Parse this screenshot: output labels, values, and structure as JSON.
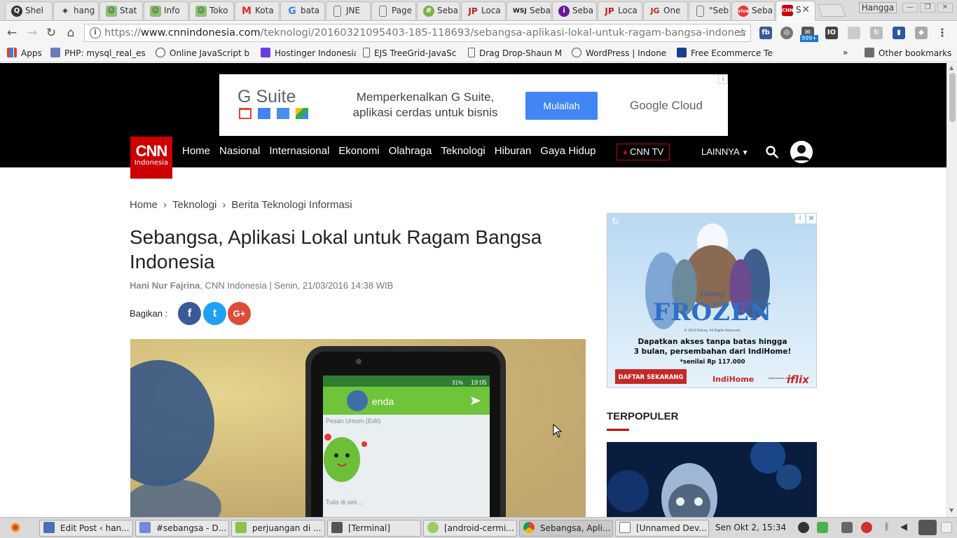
{
  "browser": {
    "tabs": [
      {
        "label": "Shel",
        "icon": "q-icon"
      },
      {
        "label": "hang",
        "icon": "superman-icon"
      },
      {
        "label": "Stat",
        "icon": "robot-icon"
      },
      {
        "label": "Info",
        "icon": "robot-icon"
      },
      {
        "label": "Toko",
        "icon": "robot-icon"
      },
      {
        "label": "Kota",
        "icon": "gmail-icon"
      },
      {
        "label": "bata",
        "icon": "google-icon"
      },
      {
        "label": "JNE",
        "icon": "page-icon"
      },
      {
        "label": "Page",
        "icon": "page-icon"
      },
      {
        "label": "Seba",
        "icon": "sheet-icon"
      },
      {
        "label": "Loca",
        "icon": "jp-icon"
      },
      {
        "label": "Seba",
        "icon": "wsj-icon"
      },
      {
        "label": "Seba",
        "icon": "info-icon"
      },
      {
        "label": "Loca",
        "icon": "jp-icon"
      },
      {
        "label": "One",
        "icon": "jg-icon"
      },
      {
        "label": "\"Seb",
        "icon": "page-icon"
      },
      {
        "label": "Seba",
        "icon": "viva-icon"
      },
      {
        "label": "S",
        "icon": "cnn-icon",
        "active": true
      }
    ],
    "profile_name": "Hangga",
    "url_protocol": "https://",
    "url_domain": "www.cnnindonesia.com",
    "url_path": "/teknologi/20160321095403-185-118693/sebangsa-aplikasi-lokal-untuk-ragam-bangsa-indones",
    "ext_badge": "999+",
    "ext_fb": "fb"
  },
  "bookmarks": [
    {
      "label": "Apps"
    },
    {
      "label": "PHP: mysql_real_esc"
    },
    {
      "label": "Online JavaScript be"
    },
    {
      "label": "Hostinger Indonesia"
    },
    {
      "label": "EJS TreeGrid-JavaScr"
    },
    {
      "label": "Drag Drop-Shaun Mc"
    },
    {
      "label": "WordPress | Indones"
    },
    {
      "label": "Free Ecommerce Ter"
    }
  ],
  "bookmarks_more": "»",
  "bookmarks_other": "Other bookmarks",
  "ad_top": {
    "brand": "G Suite",
    "text": "Memperkenalkan G Suite, aplikasi cerdas untuk bisnis",
    "button": "Mulailah",
    "partner": "Google Cloud"
  },
  "site": {
    "logo_main": "CNN",
    "logo_sub": "Indonesia",
    "nav": [
      "Home",
      "Nasional",
      "Internasional",
      "Ekonomi",
      "Olahraga",
      "Teknologi",
      "Hiburan",
      "Gaya Hidup"
    ],
    "cnn_tv": "CNN TV",
    "more": "LAINNYA"
  },
  "article": {
    "breadcrumb": [
      "Home",
      "Teknologi",
      "Berita Teknologi Informasi"
    ],
    "title": "Sebangsa, Aplikasi Lokal untuk Ragam Bangsa Indonesia",
    "author": "Hani Nur Fajrina",
    "meta": ", CNN Indonesia | Senin, 21/03/2016 14:38 WIB",
    "share_label": "Bagikan :",
    "share_buttons": [
      "f",
      "t",
      "G+"
    ],
    "photo_app_name": "enda",
    "photo_field_1": "Pesan Umum (Edit)",
    "photo_field_2": "Tulis di sini ...",
    "photo_status_time": "19:05",
    "photo_status_battery": "31%"
  },
  "side_ad": {
    "title": "FROZEN",
    "brand": "Disney",
    "copyright": "© 2013 Disney. All Rights Reserved.",
    "line1": "Dapatkan akses tanpa batas hingga",
    "line2": "3 bulan, persembahan dari IndiHome!",
    "line3": "*senilai Rp 117.000",
    "cta": "DAFTAR SEKARANG",
    "partner1": "IndiHome",
    "partner1_tag": "bekerjasama dengan",
    "partner2": "iflix"
  },
  "sidebar": {
    "popular_heading": "TERPOPULER"
  },
  "taskbar": {
    "tasks": [
      {
        "label": "Edit Post ‹ han..."
      },
      {
        "label": "#sebangsa - D..."
      },
      {
        "label": "perjuangan di ..."
      },
      {
        "label": "[Terminal]"
      },
      {
        "label": "[android-cermi..."
      },
      {
        "label": "Sebangsa, Apli..."
      },
      {
        "label": "[Unnamed Dev..."
      }
    ],
    "clock": "Sen Okt  2, 15:34"
  },
  "colors": {
    "cnn_red": "#cc0000",
    "facebook": "#3b5998",
    "twitter": "#1da1f2",
    "google_plus": "#dd4b39",
    "ad_button": "#4285f4"
  }
}
